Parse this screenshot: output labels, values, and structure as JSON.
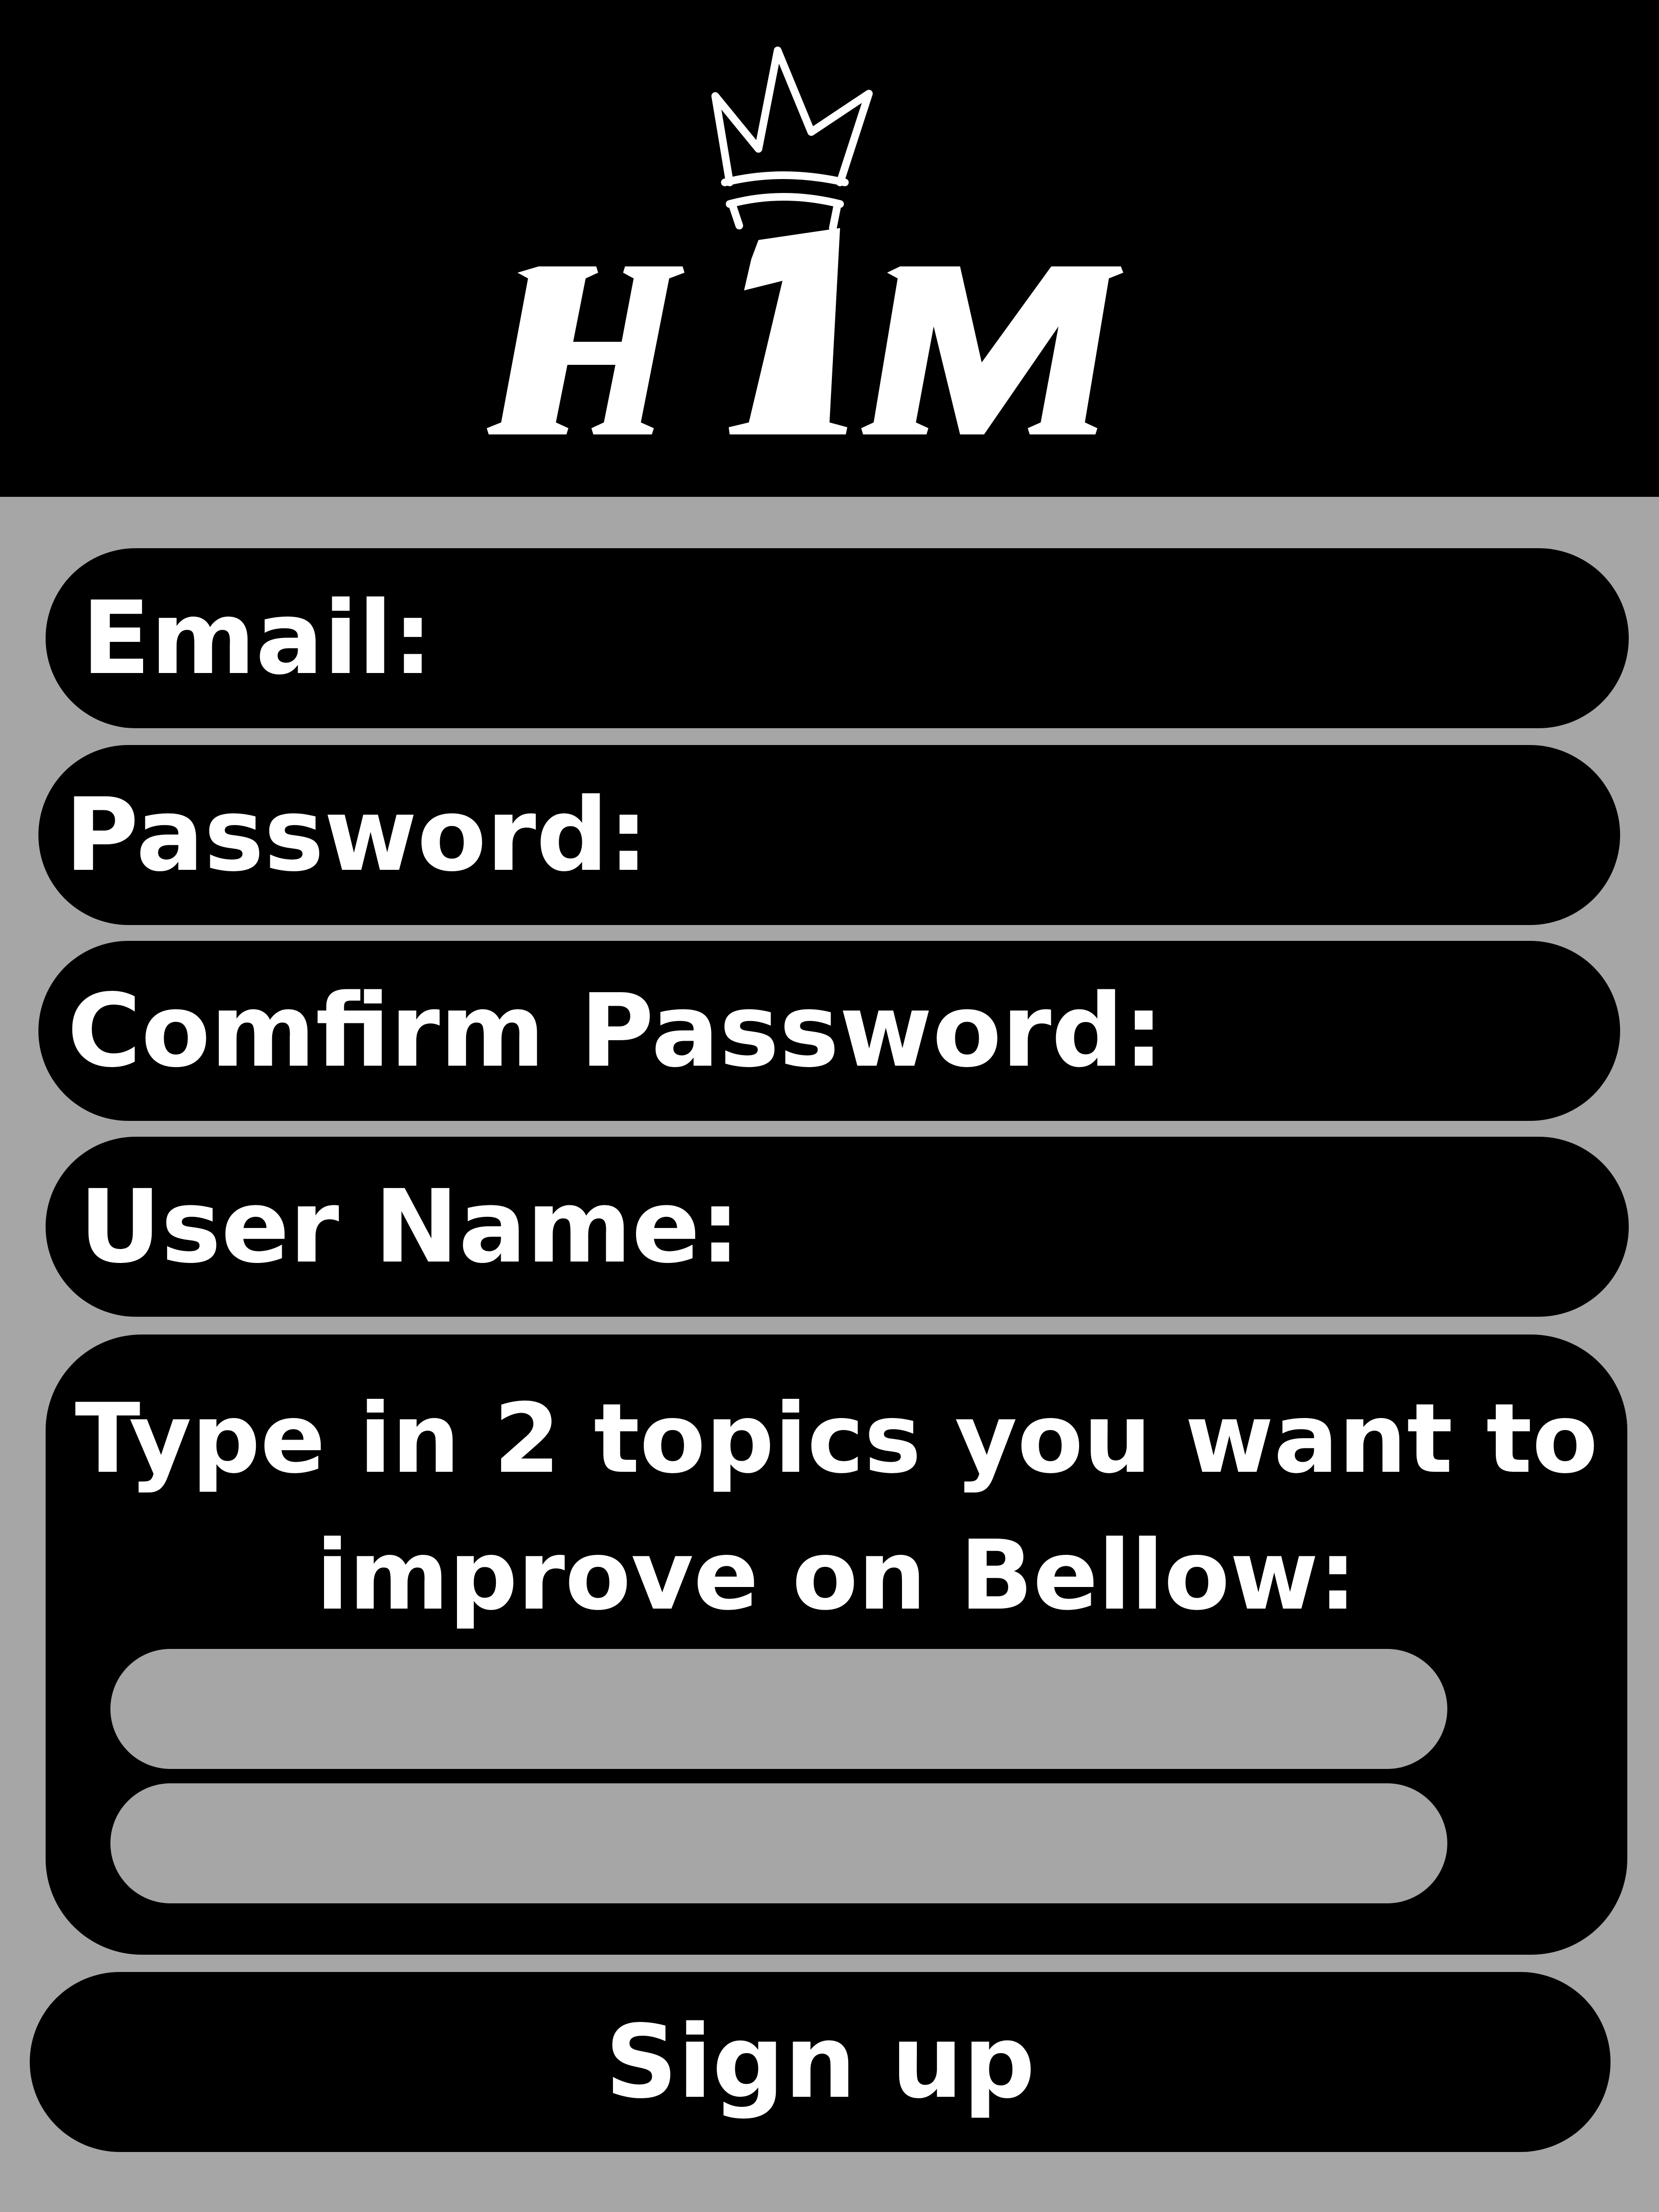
{
  "app": {
    "logo_text": "H1M",
    "logo_icon": "crown-icon"
  },
  "form": {
    "email_label": "Email:",
    "email_value": "",
    "password_label": "Password:",
    "password_value": "",
    "confirm_password_label": "Comfirm Password:",
    "confirm_password_value": "",
    "username_label": "User Name:",
    "username_value": ""
  },
  "topics": {
    "prompt_line1": "Type in 2  topics you want to",
    "prompt_line2": "improve on Bellow:",
    "topic1_value": "",
    "topic2_value": ""
  },
  "actions": {
    "signup_label": "Sign up"
  },
  "colors": {
    "background": "#a6a6a6",
    "panel": "#000000",
    "text": "#ffffff"
  }
}
